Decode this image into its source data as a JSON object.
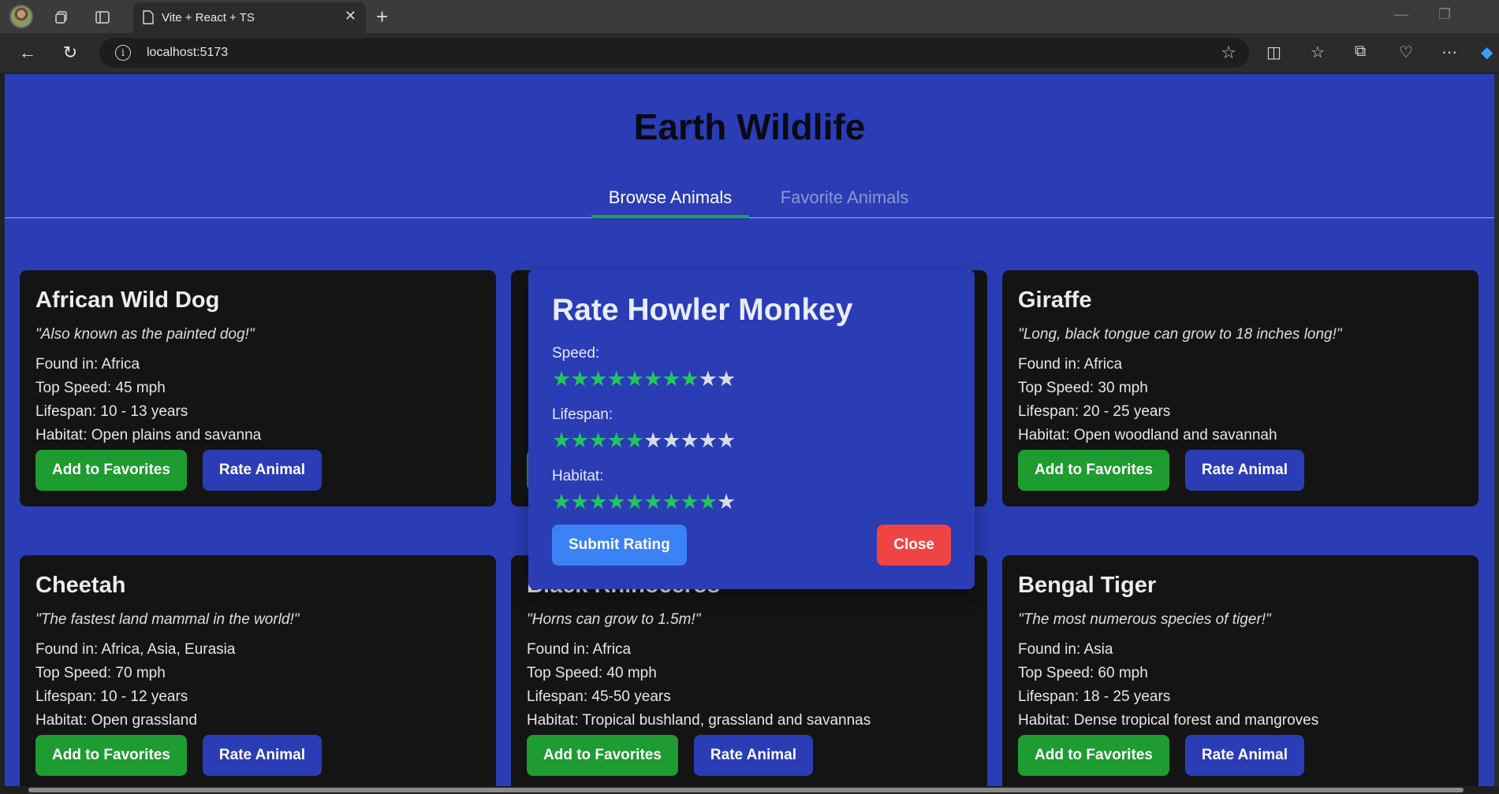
{
  "browser": {
    "tab_title": "Vite + React + TS",
    "tab_close": "✕",
    "new_tab": "+",
    "url": "localhost:5173",
    "url_info_glyph": "i"
  },
  "app": {
    "title": "Earth Wildlife",
    "tabs": [
      {
        "label": "Browse Animals",
        "active": true
      },
      {
        "label": "Favorite Animals",
        "active": false
      }
    ]
  },
  "animals": [
    {
      "name": "African Wild Dog",
      "quote": "\"Also known as the painted dog!\"",
      "found": "Found in: Africa",
      "speed": "Top Speed: 45 mph",
      "lifespan": "Lifespan: 10 - 13 years",
      "habitat": "Habitat: Open plains and savanna"
    },
    {
      "name": "Howler Monkey",
      "quote": "",
      "found": "",
      "speed": "",
      "lifespan": "",
      "habitat": ""
    },
    {
      "name": "Giraffe",
      "quote": "\"Long, black tongue can grow to 18 inches long!\"",
      "found": "Found in: Africa",
      "speed": "Top Speed: 30 mph",
      "lifespan": "Lifespan: 20 - 25 years",
      "habitat": "Habitat: Open woodland and savannah"
    },
    {
      "name": "Cheetah",
      "quote": "\"The fastest land mammal in the world!\"",
      "found": "Found in: Africa, Asia, Eurasia",
      "speed": "Top Speed: 70 mph",
      "lifespan": "Lifespan: 10 - 12 years",
      "habitat": "Habitat: Open grassland"
    },
    {
      "name": "Black Rhinoceros",
      "quote": "\"Horns can grow to 1.5m!\"",
      "found": "Found in: Africa",
      "speed": "Top Speed: 40 mph",
      "lifespan": "Lifespan: 45-50 years",
      "habitat": "Habitat: Tropical bushland, grassland and savannas"
    },
    {
      "name": "Bengal Tiger",
      "quote": "\"The most numerous species of tiger!\"",
      "found": "Found in: Asia",
      "speed": "Top Speed: 60 mph",
      "lifespan": "Lifespan: 18 - 25 years",
      "habitat": "Habitat: Dense tropical forest and mangroves"
    }
  ],
  "buttons": {
    "add_favorites": "Add to Favorites",
    "rate_animal": "Rate Animal"
  },
  "modal": {
    "title": "Rate Howler Monkey",
    "speed_label": "Speed:",
    "speed_rating": 8,
    "lifespan_label": "Lifespan:",
    "lifespan_rating": 5,
    "habitat_label": "Habitat:",
    "habitat_rating": 9,
    "max_stars": 10,
    "submit_label": "Submit Rating",
    "close_label": "Close"
  },
  "colors": {
    "page_bg": "#2a3db4",
    "card_bg": "#141414",
    "favorite_green": "#1e9b31",
    "star_on": "#22c55e",
    "submit_blue": "#3b82f6",
    "close_red": "#ef4444"
  }
}
